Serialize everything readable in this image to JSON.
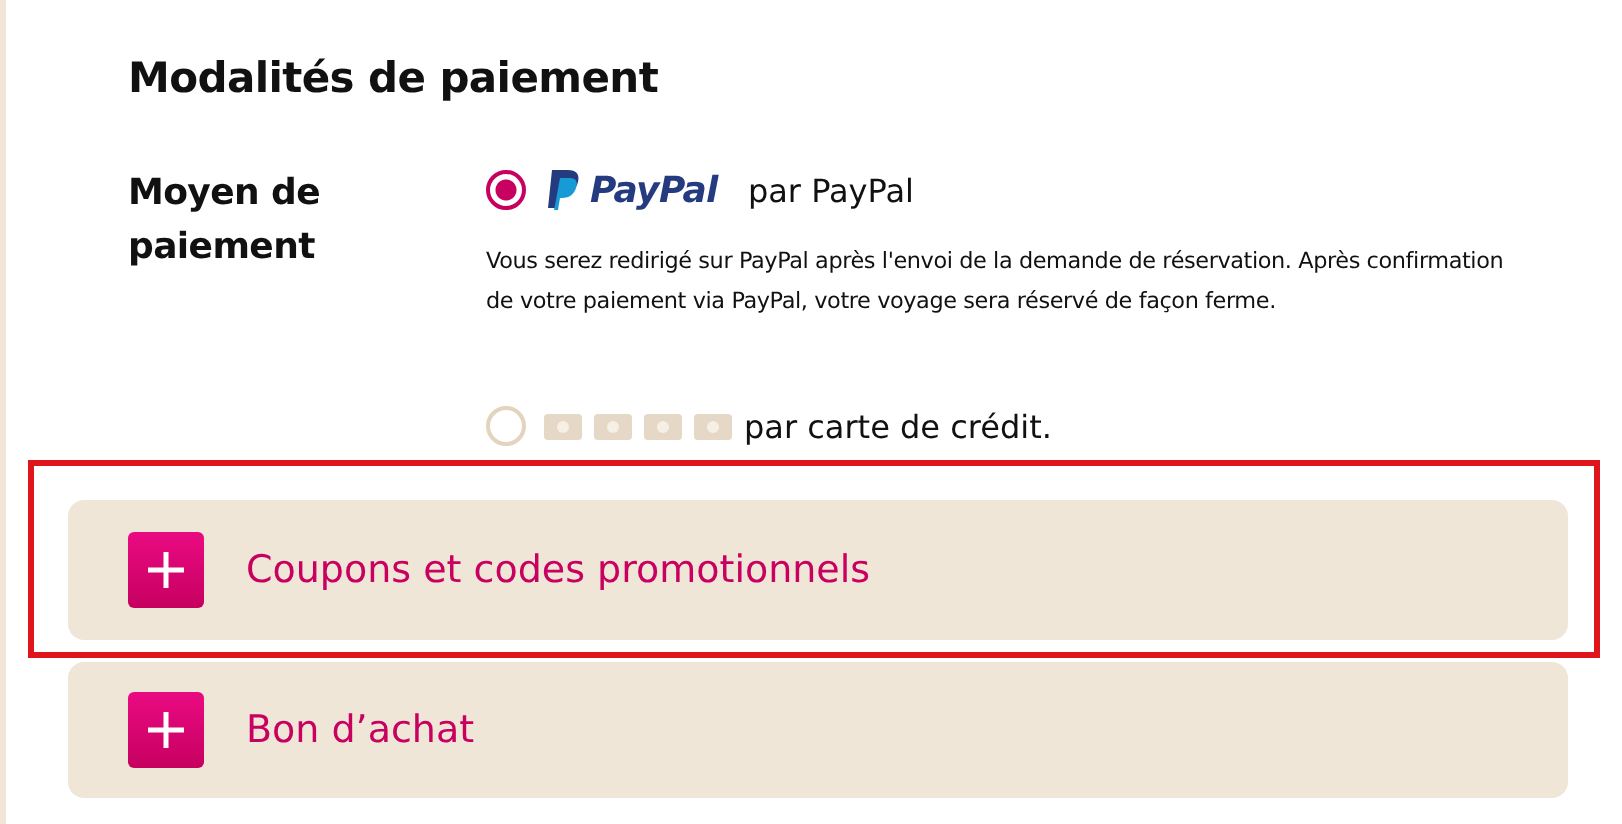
{
  "section_title": "Modalités de paiement",
  "payment": {
    "label": "Moyen de paiement",
    "options": [
      {
        "kind": "paypal",
        "selected": true,
        "logo": "PayPal",
        "label": "par PayPal",
        "description": "Vous serez redirigé sur PayPal après l'envoi de la demande de réservation. Après confirmation de votre paiement via PayPal, votre voyage sera réservé de façon ferme."
      },
      {
        "kind": "card",
        "selected": false,
        "label": "par carte de crédit."
      }
    ]
  },
  "accordions": [
    {
      "label": "Coupons et codes promotionnels",
      "highlighted": true,
      "expanded": false
    },
    {
      "label": "Bon d’achat",
      "highlighted": false,
      "expanded": false
    }
  ]
}
